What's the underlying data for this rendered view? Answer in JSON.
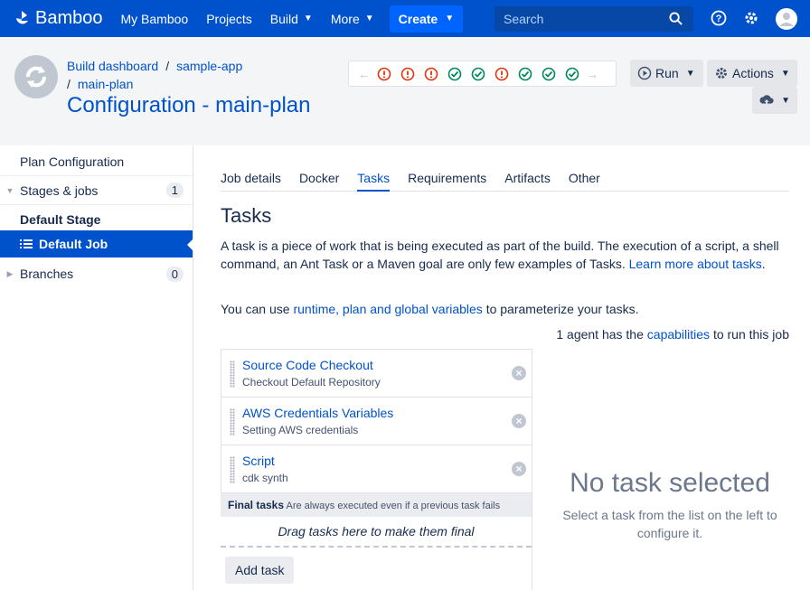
{
  "app": {
    "name": "Bamboo"
  },
  "nav": {
    "items": [
      "My Bamboo",
      "Projects",
      "Build",
      "More"
    ],
    "create": "Create",
    "search_placeholder": "Search"
  },
  "header": {
    "breadcrumb": [
      "Build dashboard",
      "sample-app",
      "main-plan"
    ],
    "title": "Configuration - main-plan",
    "build_statuses": [
      "failed",
      "failed",
      "failed",
      "success",
      "success",
      "failed",
      "success",
      "success",
      "success"
    ],
    "run_label": "Run",
    "actions_label": "Actions"
  },
  "sidebar": {
    "plan_configuration": "Plan Configuration",
    "stages_jobs": {
      "label": "Stages & jobs",
      "count": "1"
    },
    "default_stage": "Default Stage",
    "default_job": "Default Job",
    "branches": {
      "label": "Branches",
      "count": "0"
    }
  },
  "tabs": [
    "Job details",
    "Docker",
    "Tasks",
    "Requirements",
    "Artifacts",
    "Other"
  ],
  "active_tab": "Tasks",
  "main": {
    "heading": "Tasks",
    "intro": "A task is a piece of work that is being executed as part of the build. The execution of a script, a shell command, an Ant Task or a Maven goal are only few examples of Tasks.",
    "learn_more": "Learn more about tasks",
    "vars_prefix": "You can use",
    "vars_link": "runtime, plan and global variables",
    "vars_suffix": "to parameterize your tasks.",
    "agent_prefix": "1 agent has the",
    "agent_link": "capabilities",
    "agent_suffix": "to run this job"
  },
  "tasks": [
    {
      "name": "Source Code Checkout",
      "desc": "Checkout Default Repository"
    },
    {
      "name": "AWS Credentials Variables",
      "desc": "Setting AWS credentials"
    },
    {
      "name": "Script",
      "desc": "cdk synth"
    }
  ],
  "final_tasks": {
    "label": "Final tasks",
    "note": "Are always executed even if a previous task fails",
    "drop_hint": "Drag tasks here to make them final"
  },
  "add_task": "Add task",
  "empty_state": {
    "title": "No task selected",
    "subtitle": "Select a task from the list on the left to configure it."
  },
  "colors": {
    "brand": "#0052cc",
    "success": "#00875a",
    "failed": "#de350b"
  }
}
